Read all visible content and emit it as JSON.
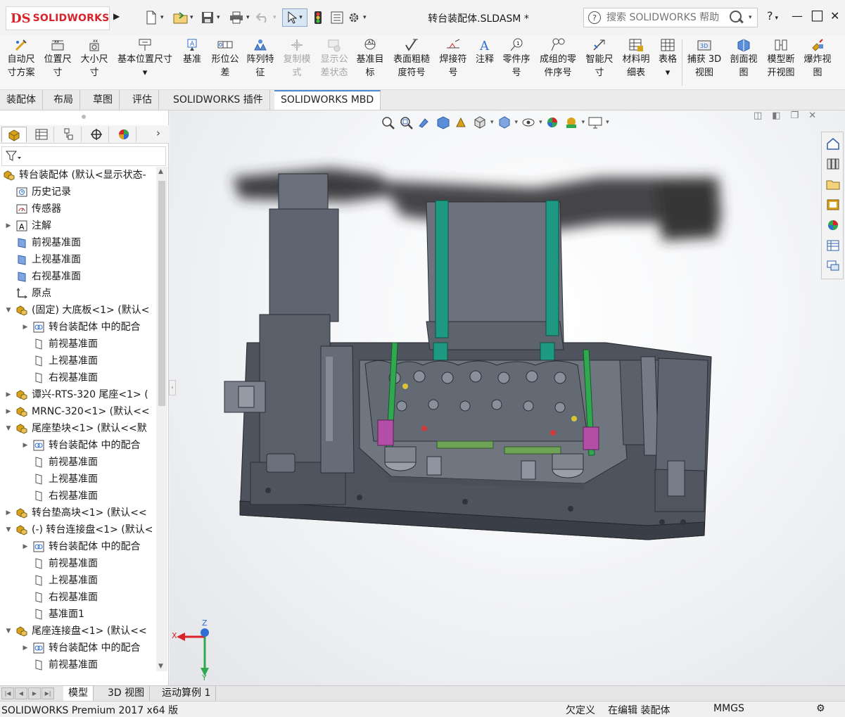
{
  "app": {
    "brand_mark": "DS",
    "brand_name": "SOLIDWORKS",
    "window_title": "转台装配体.SLDASM *",
    "help_placeholder": "搜索 SOLIDWORKS 帮助",
    "help_q": "?",
    "help_menu_label": "?",
    "minimize_label": "—",
    "restore_label": "□",
    "close_label": "✕"
  },
  "quick_access": {
    "brand_arrow": "▶",
    "new_icon": "new-document-icon",
    "open_icon": "open-folder-icon",
    "save_icon": "save-icon",
    "print_icon": "print-icon",
    "undo_icon": "undo-icon",
    "select_icon": "select-cursor-icon",
    "rebuild_icon": "traffic-light-icon",
    "file_props_icon": "file-properties-icon",
    "options_icon": "options-gear-icon"
  },
  "ribbon": {
    "items": [
      {
        "label": "自动尺\n寸方案",
        "disabled": false
      },
      {
        "label": "位置尺\n寸",
        "disabled": false
      },
      {
        "label": "大小尺\n寸",
        "disabled": false
      },
      {
        "label": "基本位置尺寸\n▾",
        "disabled": false
      },
      {
        "label": "基准",
        "disabled": false
      },
      {
        "label": "形位公\n差",
        "disabled": false
      },
      {
        "label": "阵列特\n征",
        "disabled": false
      },
      {
        "label": "复制模\n式",
        "disabled": true
      },
      {
        "label": "显示公\n差状态",
        "disabled": true
      },
      {
        "label": "基准目\n标",
        "disabled": false
      },
      {
        "label": "表面粗糙\n度符号",
        "disabled": false
      },
      {
        "label": "焊接符\n号",
        "disabled": false
      },
      {
        "label": "注释",
        "disabled": false
      },
      {
        "label": "零件序\n号",
        "disabled": false
      },
      {
        "label": "成组的零\n件序号",
        "disabled": false
      },
      {
        "label": "智能尺\n寸",
        "disabled": false
      },
      {
        "label": "材料明\n细表",
        "disabled": false
      },
      {
        "label": "表格\n▾",
        "disabled": false
      },
      {
        "label": "捕获 3D\n视图",
        "disabled": false
      },
      {
        "label": "剖面视\n图",
        "disabled": false
      },
      {
        "label": "模型断\n开视图",
        "disabled": false
      },
      {
        "label": "爆炸视\n图",
        "disabled": false
      }
    ]
  },
  "command_tabs": [
    {
      "label": "装配体",
      "active": false
    },
    {
      "label": "布局",
      "active": false
    },
    {
      "label": "草图",
      "active": false
    },
    {
      "label": "评估",
      "active": false
    },
    {
      "label": "SOLIDWORKS 插件",
      "active": false
    },
    {
      "label": "SOLIDWORKS MBD",
      "active": true
    }
  ],
  "feature_tree": {
    "more_arrow": "›",
    "filter_icon": "filter-icon",
    "nodes": [
      {
        "text": "转台装配体 (默认<显示状态-",
        "level": 0,
        "toggle": "",
        "icon": "assembly-icon"
      },
      {
        "text": "历史记录",
        "level": 1,
        "toggle": "",
        "icon": "history-icon"
      },
      {
        "text": "传感器",
        "level": 1,
        "toggle": "",
        "icon": "sensor-icon"
      },
      {
        "text": "注解",
        "level": 1,
        "toggle": "▶",
        "icon": "annotation-icon"
      },
      {
        "text": "前视基准面",
        "level": 1,
        "toggle": "",
        "icon": "plane-icon"
      },
      {
        "text": "上视基准面",
        "level": 1,
        "toggle": "",
        "icon": "plane-icon"
      },
      {
        "text": "右视基准面",
        "level": 1,
        "toggle": "",
        "icon": "plane-icon"
      },
      {
        "text": "原点",
        "level": 1,
        "toggle": "",
        "icon": "origin-icon"
      },
      {
        "text": "(固定) 大底板<1> (默认<",
        "level": 1,
        "toggle": "▼",
        "icon": "part-icon"
      },
      {
        "text": "转台装配体 中的配合",
        "level": 2,
        "toggle": "▶",
        "icon": "mate-icon"
      },
      {
        "text": "前视基准面",
        "level": 2,
        "toggle": "",
        "icon": "plane-outline-icon"
      },
      {
        "text": "上视基准面",
        "level": 2,
        "toggle": "",
        "icon": "plane-outline-icon"
      },
      {
        "text": "右视基准面",
        "level": 2,
        "toggle": "",
        "icon": "plane-outline-icon"
      },
      {
        "text": "谭兴-RTS-320 尾座<1> (",
        "level": 1,
        "toggle": "▶",
        "icon": "part-icon"
      },
      {
        "text": "MRNC-320<1> (默认<<",
        "level": 1,
        "toggle": "▶",
        "icon": "part-icon"
      },
      {
        "text": "尾座垫块<1> (默认<<默",
        "level": 1,
        "toggle": "▼",
        "icon": "part-icon"
      },
      {
        "text": "转台装配体 中的配合",
        "level": 2,
        "toggle": "▶",
        "icon": "mate-icon"
      },
      {
        "text": "前视基准面",
        "level": 2,
        "toggle": "",
        "icon": "plane-outline-icon"
      },
      {
        "text": "上视基准面",
        "level": 2,
        "toggle": "",
        "icon": "plane-outline-icon"
      },
      {
        "text": "右视基准面",
        "level": 2,
        "toggle": "",
        "icon": "plane-outline-icon"
      },
      {
        "text": "转台垫高块<1> (默认<<",
        "level": 1,
        "toggle": "▶",
        "icon": "part-icon"
      },
      {
        "text": "(-) 转台连接盘<1> (默认<",
        "level": 1,
        "toggle": "▼",
        "icon": "part-icon"
      },
      {
        "text": "转台装配体 中的配合",
        "level": 2,
        "toggle": "▶",
        "icon": "mate-icon"
      },
      {
        "text": "前视基准面",
        "level": 2,
        "toggle": "",
        "icon": "plane-outline-icon"
      },
      {
        "text": "上视基准面",
        "level": 2,
        "toggle": "",
        "icon": "plane-outline-icon"
      },
      {
        "text": "右视基准面",
        "level": 2,
        "toggle": "",
        "icon": "plane-outline-icon"
      },
      {
        "text": "基准面1",
        "level": 2,
        "toggle": "",
        "icon": "plane-outline-icon"
      },
      {
        "text": "尾座连接盘<1> (默认<<",
        "level": 1,
        "toggle": "▼",
        "icon": "part-icon"
      },
      {
        "text": "转台装配体 中的配合",
        "level": 2,
        "toggle": "▶",
        "icon": "mate-icon"
      },
      {
        "text": "前视基准面",
        "level": 2,
        "toggle": "",
        "icon": "plane-outline-icon"
      }
    ]
  },
  "bottom_tabs": [
    {
      "label": "模型",
      "active": true
    },
    {
      "label": "3D 视图",
      "active": false
    },
    {
      "label": "运动算例 1",
      "active": false
    }
  ],
  "status": {
    "product": "SOLIDWORKS Premium 2017 x64 版",
    "defined": "欠定义",
    "editing": "在编辑 装配体",
    "units": "MMGS"
  },
  "triad": {
    "x": "X",
    "y": "Y",
    "z": "Z"
  },
  "colors": {
    "brand_red": "#d9232a",
    "model_gray": "#5e6470",
    "rail_green": "#1f9a82",
    "fixture_magenta": "#b34fa6",
    "fixture_green": "#6ea357"
  }
}
